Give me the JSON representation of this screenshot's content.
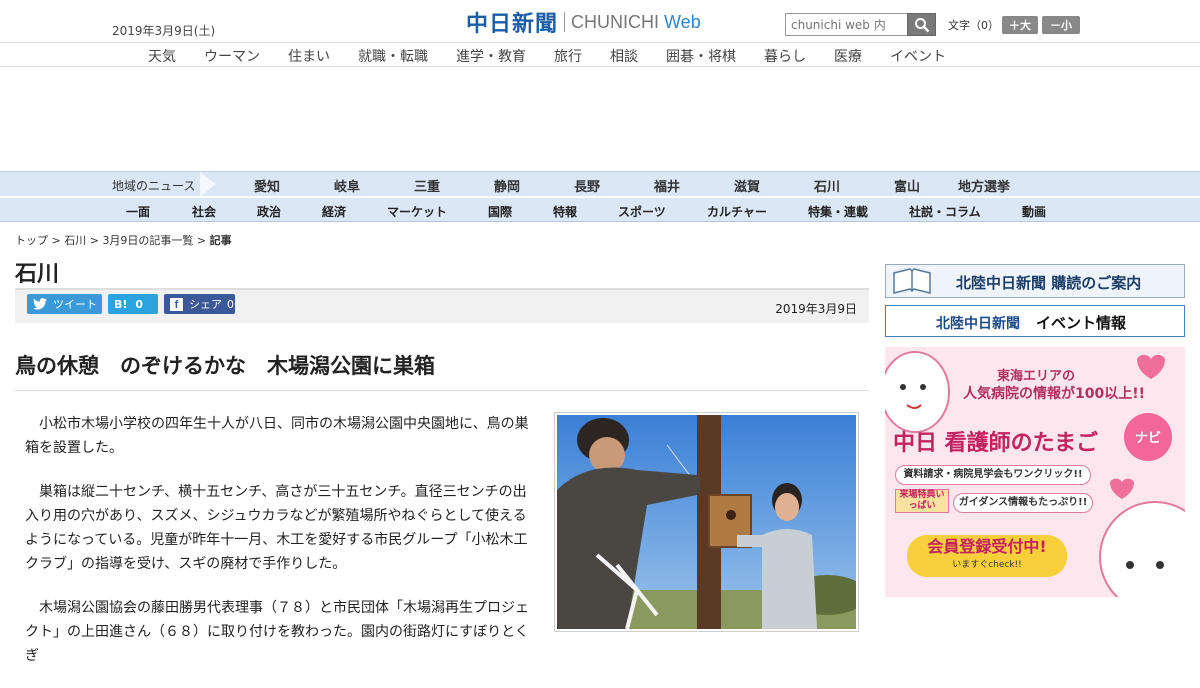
{
  "header": {
    "date": "2019年3月9日(土)",
    "logo_main": "中日新聞",
    "logo_en": "CHUNICHI",
    "logo_web": "Web",
    "search_placeholder": "chunichi web 内",
    "fontsize_label": "文字（0）",
    "font_bigger": "＋大",
    "font_smaller": "－小"
  },
  "genre_nav": [
    "天気",
    "ウーマン",
    "住まい",
    "就職・転職",
    "進学・教育",
    "旅行",
    "相談",
    "囲碁・将棋",
    "暮らし",
    "医療",
    "イベント"
  ],
  "region_nav": {
    "label": "地域のニュース",
    "items": [
      "愛知",
      "岐阜",
      "三重",
      "静岡",
      "長野",
      "福井",
      "滋賀",
      "石川",
      "富山",
      "地方選挙"
    ]
  },
  "section_nav": [
    "一面",
    "社会",
    "政治",
    "経済",
    "マーケット",
    "国際",
    "特報",
    "スポーツ",
    "カルチャー",
    "特集・連載",
    "社説・コラム",
    "動画"
  ],
  "breadcrumb": {
    "top": "トップ",
    "sep": " > ",
    "region": "石川",
    "list": "3月9日の記事一覧",
    "current": "記事"
  },
  "article": {
    "region_title": "石川",
    "tweet_label": "ツイート",
    "hatena_label": "B!",
    "hatena_count": "0",
    "share_label": "シェア",
    "share_count": "0",
    "date": "2019年3月9日",
    "headline": "鳥の休憩　のぞけるかな　木場潟公園に巣箱",
    "paragraphs": [
      "小松市木場小学校の四年生十人が八日、同市の木場潟公園中央園地に、鳥の巣箱を設置した。",
      "巣箱は縦二十センチ、横十五センチ、高さが三十五センチ。直径三センチの出入り用の穴があり、スズメ、シジュウカラなどが繁殖場所やねぐらとして使えるようになっている。児童が昨年十一月、木工を愛好する市民グループ「小松木工クラブ」の指導を受け、スギの廃材で手作りした。",
      "木場潟公園協会の藤田勝男代表理事（７８）と市民団体「木場潟再生プロジェクト」の上田進さん（６８）に取り付けを教わった。園内の街路灯にすぼりとくぎ"
    ]
  },
  "sidebar": {
    "banner1": "北陸中日新聞 購読のご案内",
    "banner2_a": "北陸中日新聞",
    "banner2_b": "イベント情報",
    "ad": {
      "line1": "東海エリアの",
      "line2": "人気病院の情報が100以上!!",
      "title": "中日 看護師のたまご",
      "navi": "ナビ",
      "pill1": "資料請求・病院見学会もワンクリック!!",
      "pill2": "ガイダンス情報もたっぷり!!",
      "tag": "来場特典いっぱい",
      "cta": "会員登録受付中!",
      "cta_sub": "いますぐcheck!!"
    }
  },
  "colors": {
    "brand_blue": "#1a5ea8",
    "nav_bg": "#dbe7f5",
    "tweet": "#3a9ad9",
    "hatena": "#2ba3e0",
    "facebook": "#3b5998"
  }
}
